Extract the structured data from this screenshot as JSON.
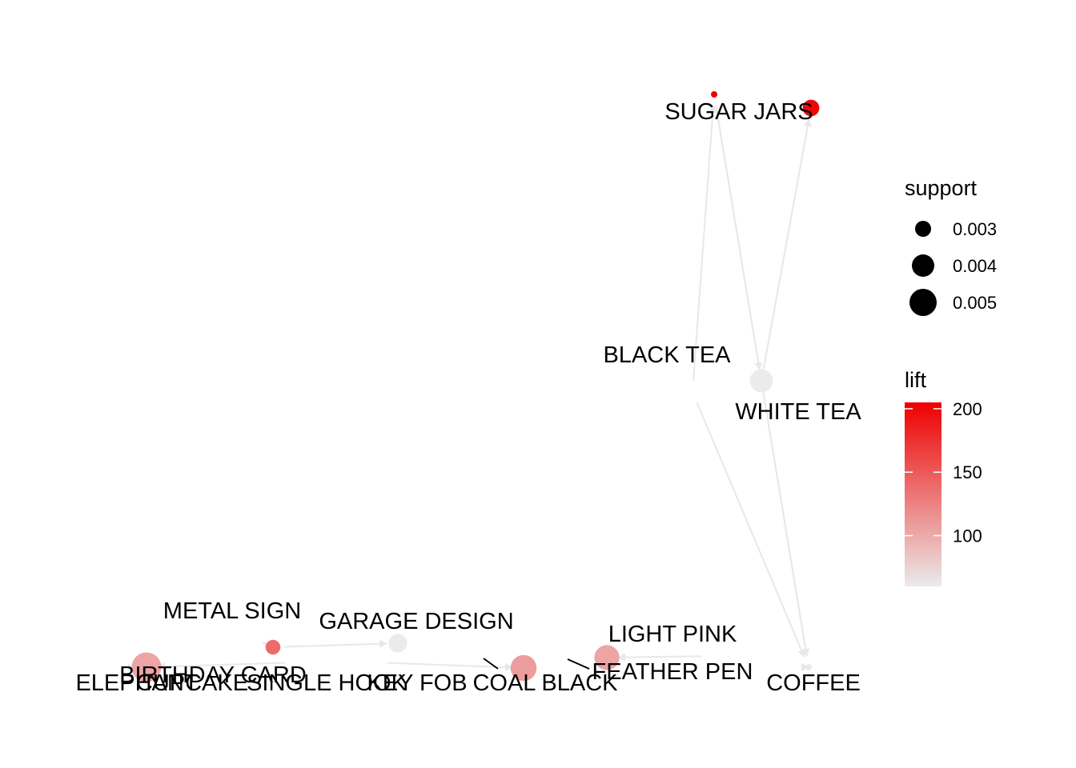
{
  "chart_data": {
    "type": "network",
    "nodes": [
      {
        "id": "sugar_jars",
        "label": "SUGAR JARS"
      },
      {
        "id": "black_tea",
        "label": "BLACK TEA"
      },
      {
        "id": "white_tea",
        "label": "WHITE TEA"
      },
      {
        "id": "coffee",
        "label": "COFFEE"
      },
      {
        "id": "metal_sign",
        "label": "METAL SIGN"
      },
      {
        "id": "garage_design",
        "label": "GARAGE DESIGN"
      },
      {
        "id": "light_pink",
        "label": "LIGHT PINK"
      },
      {
        "id": "feather_pen",
        "label": "FEATHER PEN"
      },
      {
        "id": "coal_black",
        "label": "COAL BLACK"
      },
      {
        "id": "key_fob",
        "label": "KEY FOB"
      },
      {
        "id": "birthday_card",
        "label": "BIRTHDAY CARD"
      },
      {
        "id": "elephant",
        "label": "ELEPHANT"
      },
      {
        "id": "cupcake",
        "label": "CUPCAKE"
      },
      {
        "id": "single_hook",
        "label": "SINGLE HOOK"
      }
    ],
    "rules": [
      {
        "id": "r1",
        "support": 0.0027,
        "lift": 205
      },
      {
        "id": "r2",
        "support": 0.0038,
        "lift": 200
      },
      {
        "id": "r3",
        "support": 0.0045,
        "lift": 62
      },
      {
        "id": "r4",
        "support": 0.004,
        "lift": 62
      },
      {
        "id": "r5",
        "support": 0.0036,
        "lift": 140
      },
      {
        "id": "r6",
        "support": 0.0048,
        "lift": 62
      },
      {
        "id": "r7",
        "support": 0.0048,
        "lift": 110
      },
      {
        "id": "r8",
        "support": 0.0047,
        "lift": 105
      },
      {
        "id": "r9",
        "support": 0.0027,
        "lift": 62
      },
      {
        "id": "r10",
        "support": 0.0052,
        "lift": 105
      }
    ],
    "edges": [
      [
        "black_tea",
        "r1"
      ],
      [
        "r1",
        "white_tea"
      ],
      [
        "r2",
        "sugar_jars"
      ],
      [
        "white_tea",
        "r2"
      ],
      [
        "black_tea",
        "coffee"
      ],
      [
        "white_tea",
        "coffee"
      ],
      [
        "r1",
        "coffee"
      ],
      [
        "metal_sign",
        "r5"
      ],
      [
        "r5",
        "garage_design"
      ],
      [
        "key_fob",
        "r6"
      ],
      [
        "coal_black",
        "r7"
      ],
      [
        "feather_pen",
        "r8"
      ],
      [
        "r9",
        "coffee"
      ],
      [
        "elephant",
        "r10"
      ],
      [
        "birthday_card",
        "r10"
      ]
    ],
    "legend": {
      "size_title": "support",
      "size_breaks": [
        {
          "label": "0.003",
          "value": 0.003
        },
        {
          "label": "0.004",
          "value": 0.004
        },
        {
          "label": "0.005",
          "value": 0.005
        }
      ],
      "color_title": "lift",
      "color_breaks": [
        {
          "label": "200",
          "value": 200
        },
        {
          "label": "150",
          "value": 150
        },
        {
          "label": "100",
          "value": 100
        }
      ],
      "lift_range": [
        62,
        205
      ],
      "color_low": "#ebebeb",
      "color_high": "#ee0000"
    }
  }
}
